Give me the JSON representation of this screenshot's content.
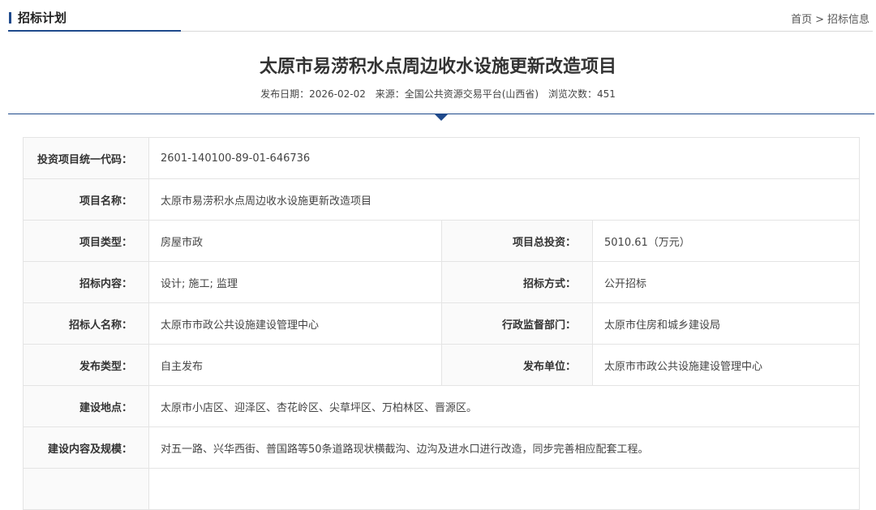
{
  "section": {
    "title": "招标计划"
  },
  "breadcrumb": {
    "home": "首页",
    "separator": ">",
    "current": "招标信息"
  },
  "article": {
    "title": "太原市易涝积水点周边收水设施更新改造项目",
    "publish_date_label": "发布日期：",
    "publish_date": "2026-02-02",
    "source_label": "来源：",
    "source": "全国公共资源交易平台(山西省)",
    "views_label": "浏览次数：",
    "views": "451"
  },
  "details": {
    "code_label": "投资项目统一代码：",
    "code": "2601-140100-89-01-646736",
    "name_label": "项目名称：",
    "name": "太原市易涝积水点周边收水设施更新改造项目",
    "type_label": "项目类型：",
    "type": "房屋市政",
    "investment_label": "项目总投资：",
    "investment": "5010.61（万元）",
    "content_label": "招标内容：",
    "content": "设计; 施工; 监理",
    "method_label": "招标方式：",
    "method": "公开招标",
    "tenderer_label": "招标人名称：",
    "tenderer": "太原市市政公共设施建设管理中心",
    "supervisor_label": "行政监督部门：",
    "supervisor": "太原市住房和城乡建设局",
    "release_type_label": "发布类型：",
    "release_type": "自主发布",
    "release_unit_label": "发布单位：",
    "release_unit": "太原市市政公共设施建设管理中心",
    "location_label": "建设地点：",
    "location": "太原市小店区、迎泽区、杏花岭区、尖草坪区、万柏林区、晋源区。",
    "scope_label": "建设内容及规模：",
    "scope": "对五一路、兴华西街、普国路等50条道路现状横截沟、边沟及进水口进行改造，同步完善相应配套工程。"
  },
  "colors": {
    "accent": "#1f4a8c",
    "border": "#e4e4e4"
  }
}
